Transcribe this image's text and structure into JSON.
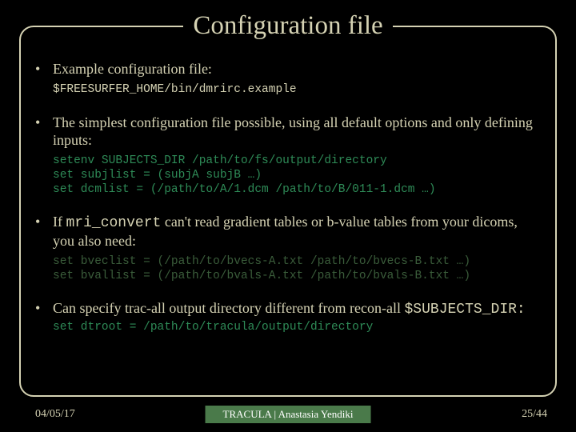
{
  "title": "Configuration file",
  "bullets": {
    "b1": "Example configuration file:",
    "b1_sub": "$FREESURFER_HOME/bin/dmrirc.example",
    "b2": "The simplest configuration file possible, using all default options and only defining inputs:",
    "b2_code": "setenv SUBJECTS_DIR /path/to/fs/output/directory\nset subjlist = (subjA subjB …)\nset dcmlist = (/path/to/A/1.dcm /path/to/B/011-1.dcm …)",
    "b3_pre": "If ",
    "b3_code": "mri_convert",
    "b3_post": " can't read gradient tables or b-value tables from your dicoms, you also need:",
    "b3_codeblock": "set bveclist = (/path/to/bvecs-A.txt /path/to/bvecs-B.txt …)\nset bvallist = (/path/to/bvals-A.txt /path/to/bvals-B.txt …)",
    "b4": "Can specify trac-all output directory different from recon-all ",
    "b4_sub": "$SUBJECTS_DIR:",
    "b4_code": "set dtroot = /path/to/tracula/output/directory"
  },
  "footer": {
    "date": "04/05/17",
    "center": "TRACULA | Anastasia Yendiki",
    "page": "25/44"
  }
}
